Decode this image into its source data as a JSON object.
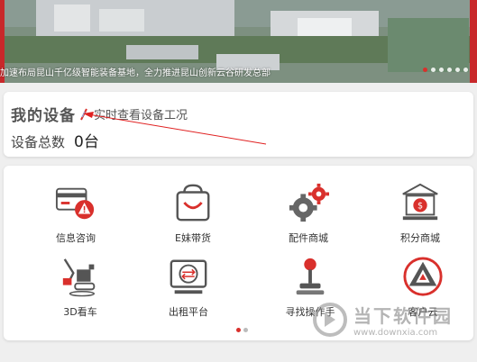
{
  "banner": {
    "caption": "加速布局昆山千亿级智能装备基地，全力推进昆山创新云谷研发总部",
    "dots": 6
  },
  "devices": {
    "title": "我的设备",
    "subtitle": "实时查看设备工况",
    "count_label": "设备总数",
    "count_value": "0台"
  },
  "services": [
    {
      "label": "信息咨询",
      "icon": "info-consult-icon"
    },
    {
      "label": "E妹带货",
      "icon": "shopping-bag-icon"
    },
    {
      "label": "配件商城",
      "icon": "gears-icon"
    },
    {
      "label": "积分商城",
      "icon": "points-bank-icon"
    },
    {
      "label": "3D看车",
      "icon": "excavator-3d-icon"
    },
    {
      "label": "出租平台",
      "icon": "rental-screen-icon"
    },
    {
      "label": "寻找操作手",
      "icon": "joystick-icon"
    },
    {
      "label": "客户云",
      "icon": "triangle-logo-icon"
    }
  ],
  "pager": {
    "total": 2,
    "active": 0
  },
  "watermark": {
    "cn": "当下软件园",
    "url": "www.downxia.com"
  },
  "colors": {
    "accent": "#d9302c",
    "text": "#333333",
    "bg": "#efefef"
  }
}
